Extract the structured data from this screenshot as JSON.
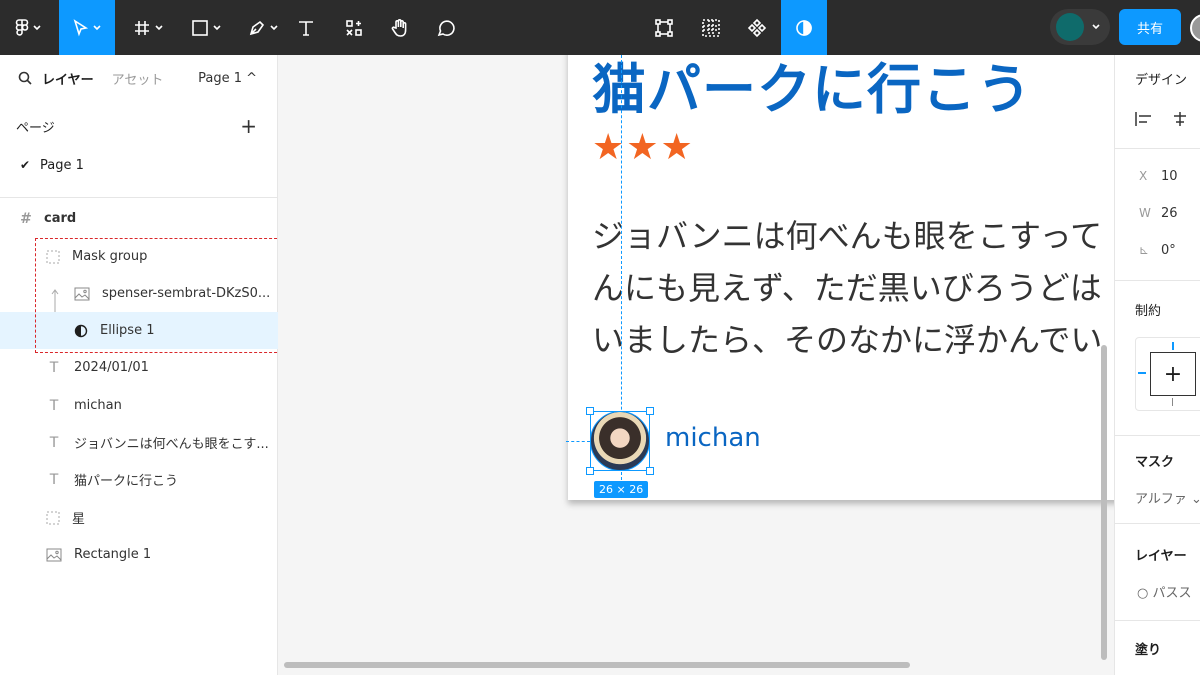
{
  "toolbar": {
    "share_label": "共有"
  },
  "left_panel": {
    "tab_layers": "レイヤー",
    "tab_assets": "アセット",
    "page_selector": "Page 1 ^",
    "pages_heading": "ページ",
    "add_page": "+",
    "pages": [
      {
        "label": "Page 1",
        "check": "✔"
      }
    ],
    "layers": [
      {
        "label": "card"
      },
      {
        "label": "Mask group"
      },
      {
        "label": "spenser-sembrat-DKzS0..."
      },
      {
        "label": "Ellipse 1"
      },
      {
        "label": "2024/01/01"
      },
      {
        "label": "michan"
      },
      {
        "label": "ジョバンニは何べんも眼をこす..."
      },
      {
        "label": "猫パークに行こう"
      },
      {
        "label": "星"
      },
      {
        "label": "Rectangle 1"
      }
    ]
  },
  "canvas": {
    "title": "猫パークに行こう",
    "stars": "★★★",
    "body": "ジョバンニは何べんも眼をこすって\nんにも見えず、ただ黒いびろうどは\nいましたら、そのなかに浮かんでい",
    "author": "michan",
    "selection_size": "26 × 26"
  },
  "right_panel": {
    "design": "デザイン",
    "x_key": "X",
    "x_val": "10",
    "w_key": "W",
    "w_val": "26",
    "r_key": "⊾",
    "r_val": "0°",
    "constraints": "制約",
    "mask": "マスク",
    "mask_mode": "アルファ ⌄",
    "layer": "レイヤー",
    "layer_mode": "○ パスス",
    "fill": "塗り"
  },
  "colors": {
    "accent": "#0d99ff",
    "title": "#0a66c2",
    "stars": "#f26522",
    "highlight_box": "#d9262a"
  }
}
